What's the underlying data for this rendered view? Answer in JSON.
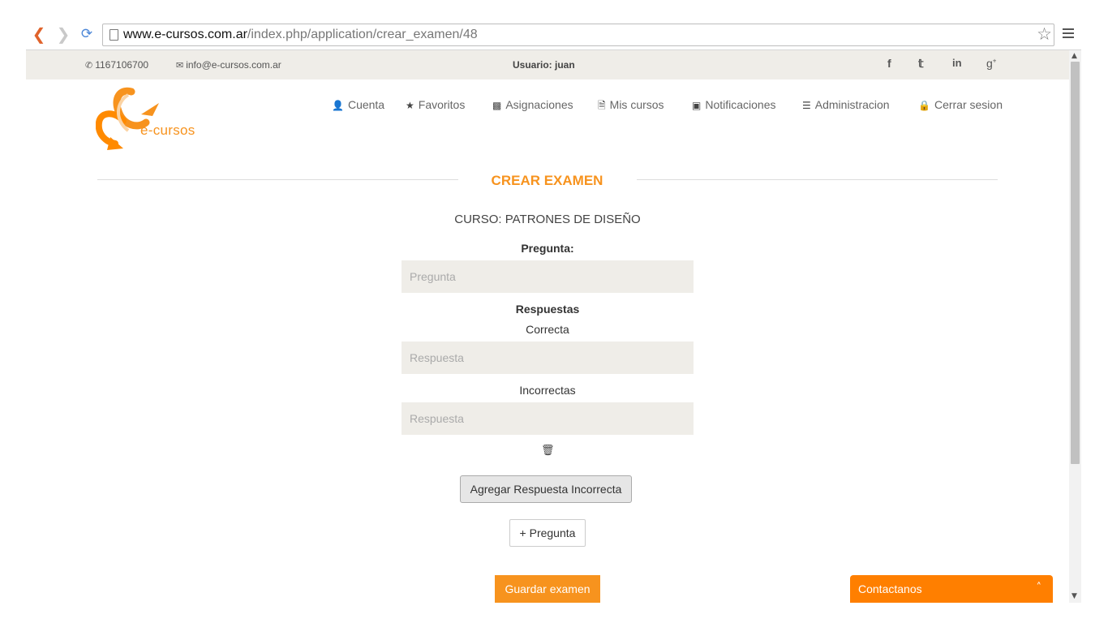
{
  "browser": {
    "url_host": "www.e-cursos.com.ar",
    "url_path": "/index.php/application/crear_examen/48"
  },
  "topbar": {
    "phone": "1167106700",
    "email": "info@e-cursos.com.ar",
    "user_label": "Usuario: juan",
    "social": [
      "f",
      "t",
      "in",
      "g+"
    ]
  },
  "brand": {
    "logo_text": "e-cursos",
    "accent": "#f7931e"
  },
  "nav": {
    "items": [
      {
        "label": "Cuenta",
        "icon": "user-icon"
      },
      {
        "label": "Favoritos",
        "icon": "star-icon"
      },
      {
        "label": "Asignaciones",
        "icon": "assignment-icon"
      },
      {
        "label": "Mis cursos",
        "icon": "document-icon"
      },
      {
        "label": "Notificaciones",
        "icon": "inbox-icon"
      },
      {
        "label": "Administracion",
        "icon": "list-icon"
      },
      {
        "label": "Cerrar sesion",
        "icon": "lock-icon"
      }
    ]
  },
  "main": {
    "title": "CREAR EXAMEN",
    "course": "CURSO: PATRONES DE DISEÑO",
    "question_label": "Pregunta:",
    "question_placeholder": "Pregunta",
    "answers_label": "Respuestas",
    "correct_label": "Correcta",
    "answer_placeholder": "Respuesta",
    "incorrect_label": "Incorrectas",
    "add_incorrect_button": "Agregar Respuesta Incorrecta",
    "add_question_button": "+ Pregunta",
    "save_button": "Guardar examen"
  },
  "contact_widget": {
    "label": "Contactanos"
  }
}
